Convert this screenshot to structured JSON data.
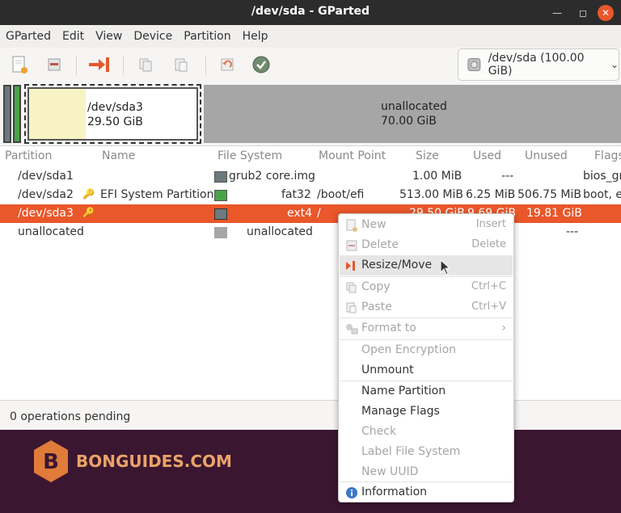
{
  "window": {
    "title": "/dev/sda - GParted"
  },
  "menu": [
    "GParted",
    "Edit",
    "View",
    "Device",
    "Partition",
    "Help"
  ],
  "device_selector": {
    "label": "/dev/sda (100.00 GiB)"
  },
  "disk_map": {
    "selected": {
      "name": "/dev/sda3",
      "size": "29.50 GiB"
    },
    "unallocated": {
      "name": "unallocated",
      "size": "70.00 GiB"
    }
  },
  "columns": [
    "Partition",
    "Name",
    "File System",
    "Mount Point",
    "Size",
    "Used",
    "Unused",
    "Flags"
  ],
  "rows": [
    {
      "partition": "/dev/sda1",
      "name": "",
      "fs": "grub2 core.img",
      "mount": "",
      "size": "1.00 MiB",
      "used": "---",
      "unused": "",
      "flags": "bios_gr",
      "color": "#6c7a7e"
    },
    {
      "partition": "/dev/sda2",
      "name": "EFI System Partition",
      "fs": "fat32",
      "mount": "/boot/efi",
      "size": "513.00 MiB",
      "used": "6.25 MiB",
      "unused": "506.75 MiB",
      "flags": "boot, e",
      "color": "#49a348"
    },
    {
      "partition": "/dev/sda3",
      "name": "",
      "fs": "ext4",
      "mount": "/",
      "size": "29.50 GiB",
      "used": "9.69 GiB",
      "unused": "19.81 GiB",
      "flags": "",
      "color": "#6c7a7e"
    },
    {
      "partition": "unallocated",
      "name": "",
      "fs": "unallocated",
      "mount": "",
      "size": "",
      "used": "",
      "unused": "---",
      "flags": "",
      "color": "#a6a6a6"
    }
  ],
  "status": {
    "text": "0 operations pending"
  },
  "brand": {
    "text": "BONGUIDES.COM",
    "letter": "B"
  },
  "context_menu": {
    "items": [
      {
        "label": "New",
        "accel": "Insert",
        "enabled": false,
        "icon": "new-icon"
      },
      {
        "label": "Delete",
        "accel": "Delete",
        "enabled": false,
        "icon": "delete-icon"
      },
      {
        "label": "Resize/Move",
        "accel": "",
        "enabled": true,
        "icon": "resize-icon"
      },
      {
        "label": "Copy",
        "accel": "Ctrl+C",
        "enabled": false,
        "icon": "copy-icon"
      },
      {
        "label": "Paste",
        "accel": "Ctrl+V",
        "enabled": false,
        "icon": "paste-icon"
      },
      {
        "label": "Format to",
        "accel": "",
        "enabled": false,
        "icon": "format-icon"
      },
      {
        "label": "Open Encryption",
        "accel": "",
        "enabled": false,
        "icon": ""
      },
      {
        "label": "Unmount",
        "accel": "",
        "enabled": true,
        "icon": ""
      },
      {
        "label": "Name Partition",
        "accel": "",
        "enabled": true,
        "icon": ""
      },
      {
        "label": "Manage Flags",
        "accel": "",
        "enabled": true,
        "icon": ""
      },
      {
        "label": "Check",
        "accel": "",
        "enabled": false,
        "icon": ""
      },
      {
        "label": "Label File System",
        "accel": "",
        "enabled": false,
        "icon": ""
      },
      {
        "label": "New UUID",
        "accel": "",
        "enabled": false,
        "icon": ""
      },
      {
        "label": "Information",
        "accel": "",
        "enabled": true,
        "icon": "info-icon"
      }
    ]
  }
}
